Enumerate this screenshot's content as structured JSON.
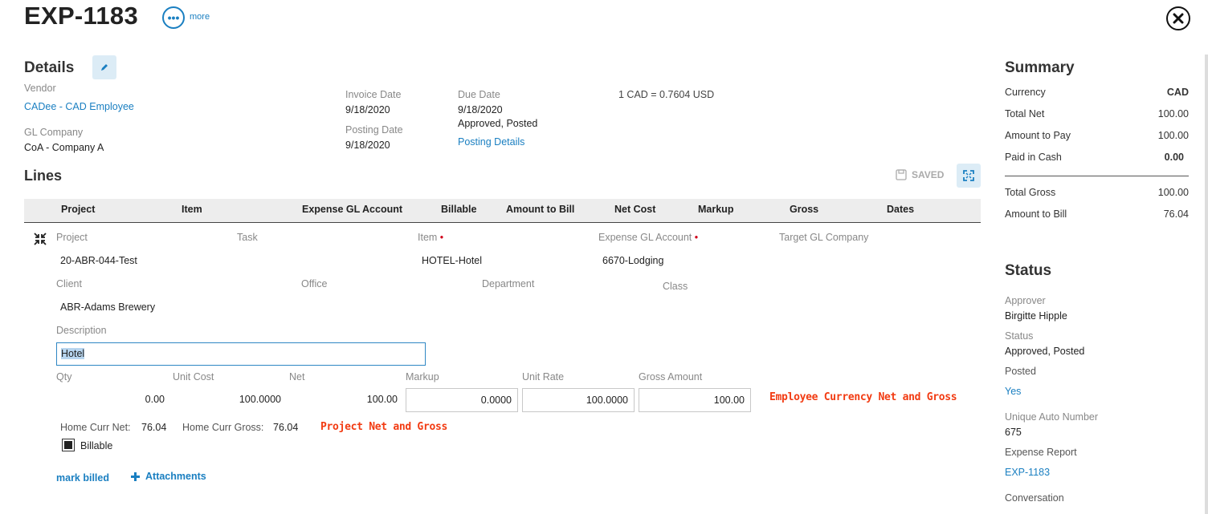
{
  "header": {
    "title": "EXP-1183",
    "more_label": "more",
    "more_icon": "ellipsis-icon",
    "close_icon": "close-icon"
  },
  "details": {
    "heading": "Details",
    "vendor_label": "Vendor",
    "vendor_value": "CADee - CAD Employee",
    "gl_company_label": "GL Company",
    "gl_company_value": "CoA - Company A",
    "invoice_date_label": "Invoice Date",
    "invoice_date_value": "9/18/2020",
    "posting_date_label": "Posting Date",
    "posting_date_value": "9/18/2020",
    "due_date_label": "Due Date",
    "due_date_value": "9/18/2020",
    "due_status": "Approved, Posted",
    "posting_details_link": "Posting Details",
    "exchange_rate": "1 CAD = 0.7604 USD"
  },
  "lines": {
    "heading": "Lines",
    "saved_label": "SAVED",
    "columns": [
      "Project",
      "Item",
      "Expense GL Account",
      "Billable",
      "Amount to Bill",
      "Net Cost",
      "Markup",
      "Gross",
      "Dates"
    ],
    "row": {
      "project_label": "Project",
      "project_value": "20-ABR-044-Test",
      "task_label": "Task",
      "item_label": "Item",
      "item_value": "HOTEL-Hotel",
      "expense_gl_label": "Expense GL Account",
      "expense_gl_value": "6670-Lodging",
      "target_gl_label": "Target GL Company",
      "client_label": "Client",
      "client_value": "ABR-Adams Brewery",
      "office_label": "Office",
      "department_label": "Department",
      "class_label": "Class",
      "description_label": "Description",
      "description_value": "Hotel",
      "qty_label": "Qty",
      "qty_value": "0.00",
      "unit_cost_label": "Unit Cost",
      "unit_cost_value": "100.0000",
      "net_label": "Net",
      "net_value": "100.00",
      "markup_label": "Markup",
      "markup_value": "0.0000",
      "unit_rate_label": "Unit Rate",
      "unit_rate_value": "100.0000",
      "gross_amount_label": "Gross Amount",
      "gross_amount_value": "100.00",
      "employee_note": "Employee Currency Net and Gross",
      "home_net_label": "Home Curr Net:",
      "home_net_value": "76.04",
      "home_gross_label": "Home Curr Gross:",
      "home_gross_value": "76.04",
      "project_note": "Project Net and Gross",
      "billable_label": "Billable",
      "billable_checked": true,
      "mark_billed": "mark billed",
      "attachments": "Attachments"
    }
  },
  "summary": {
    "heading": "Summary",
    "rows": [
      {
        "label": "Currency",
        "value": "CAD"
      },
      {
        "label": "Total Net",
        "value": "100.00"
      },
      {
        "label": "Amount to Pay",
        "value": "100.00"
      },
      {
        "label": "Paid in Cash",
        "value": "0.00"
      },
      {
        "label": "Total Gross",
        "value": "100.00"
      },
      {
        "label": "Amount to Bill",
        "value": "76.04"
      }
    ]
  },
  "status": {
    "heading": "Status",
    "approver_label": "Approver",
    "approver_value": "Birgitte Hipple",
    "status_label": "Status",
    "status_value": "Approved, Posted",
    "posted_label": "Posted",
    "posted_value": "Yes",
    "auto_number_label": "Unique Auto Number",
    "auto_number_value": "675",
    "expense_report_label": "Expense Report",
    "expense_report_value": "EXP-1183",
    "conversation_label": "Conversation"
  },
  "colors": {
    "link": "#1a7fc1",
    "note_red": "#f23b12",
    "required_dot": "#d0021b",
    "table_header_bg": "#ededed"
  }
}
